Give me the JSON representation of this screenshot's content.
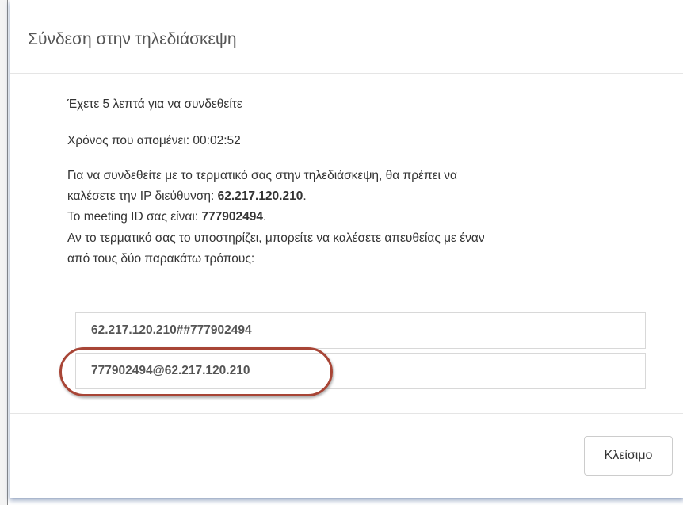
{
  "dialog": {
    "title": "Σύνδεση στην τηλεδιάσκεψη"
  },
  "body": {
    "time_limit": "Έχετε 5 λεπτά για να συνδεθείτε",
    "time_remaining": "Χρόνος που απομένει: 00:02:52",
    "instructions_line1": "Για να συνδεθείτε με το τερματικό σας στην τηλεδιάσκεψη, θα πρέπει να",
    "instructions_line2_prefix": "καλέσετε την IP διεύθυνση: ",
    "ip_address": "62.217.120.210",
    "instructions_line2_suffix": ".",
    "meeting_prefix": "Το meeting ID σας είναι: ",
    "meeting_id": "777902494",
    "meeting_suffix": ".",
    "instructions_line4": "Αν το τερματικό σας το υποστηρίζει, μπορείτε να καλέσετε απευθείας με έναν",
    "instructions_line5": "από τους δύο παρακάτω τρόπους:"
  },
  "addresses": [
    "62.217.120.210##777902494",
    "777902494@62.217.120.210"
  ],
  "footer": {
    "close_label": "Κλείσιμο"
  },
  "colors": {
    "highlight_ring": "#a84536",
    "dialog_shadow": "#3c5a8c"
  }
}
